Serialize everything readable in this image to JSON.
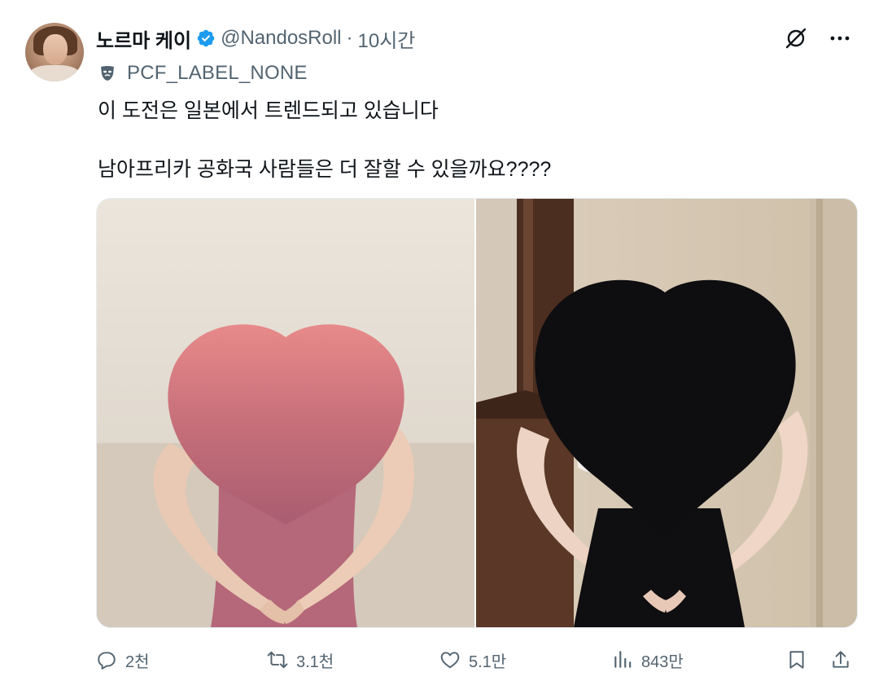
{
  "author": {
    "display_name": "노르마 케이",
    "handle": "@NandosRoll",
    "separator": "·",
    "time": "10시간",
    "verified_color": "#1d9bf0"
  },
  "label": {
    "icon": "mask-icon",
    "text": "PCF_LABEL_NONE"
  },
  "tweet_text": {
    "line1": "이 도전은 일본에서 트렌드되고 있습니다",
    "line2": "남아프리카 공화국 사람들은 더 잘할 수 있을까요????"
  },
  "media": {
    "left_heart_color": "#d6767c",
    "right_heart_color": "#0e0d10"
  },
  "actions": {
    "replies": "2천",
    "retweets": "3.1천",
    "likes": "5.1만",
    "views": "843만"
  },
  "colors": {
    "text_primary": "#0f1419",
    "text_secondary": "#536471"
  }
}
